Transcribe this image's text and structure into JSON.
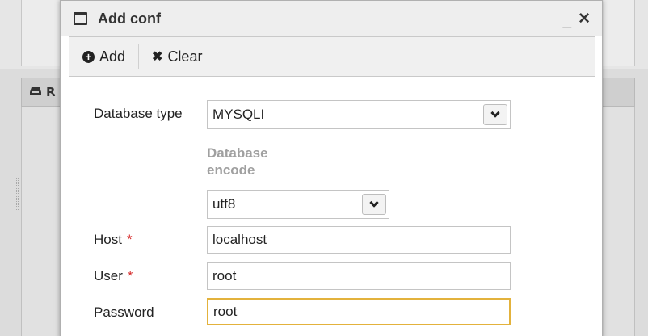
{
  "background": {
    "section_label": "R"
  },
  "modal": {
    "title": "Add conf",
    "minimize": "_",
    "close": "✕"
  },
  "toolbar": {
    "add_label": "Add",
    "clear_label": "Clear"
  },
  "form": {
    "db_type_label": "Database type",
    "db_type_value": "MYSQLI",
    "db_encode_label": "Database encode",
    "db_encode_value": "utf8",
    "host_label": "Host",
    "host_value": "localhost",
    "user_label": "User",
    "user_value": "root",
    "password_label": "Password",
    "password_value": "root",
    "required_mark": "*"
  },
  "colors": {
    "focus_border": "#e3b23c",
    "required": "#d62b2b",
    "muted_label": "#a0a0a0"
  }
}
